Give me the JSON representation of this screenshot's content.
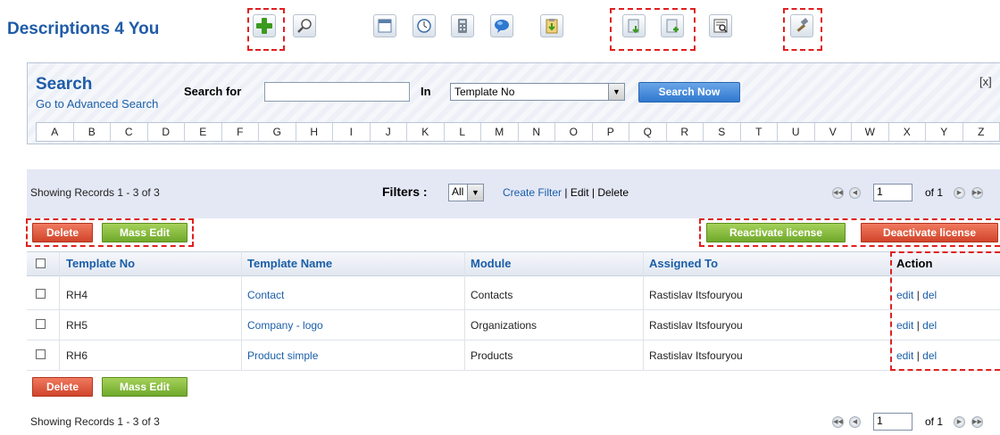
{
  "app": {
    "title": "Descriptions 4 You"
  },
  "toolbar": {
    "icons": [
      "add-icon",
      "search-icon",
      "calendar-icon",
      "clock-icon",
      "calculator-icon",
      "chat-icon",
      "clipboard-import-icon",
      "import-icon",
      "export-icon",
      "find-duplicates-icon",
      "settings-hammer-icon"
    ]
  },
  "search": {
    "title": "Search",
    "advanced_link": "Go to Advanced Search",
    "search_for_label": "Search for",
    "search_value": "",
    "in_label": "In",
    "in_selected": "Template No",
    "button": "Search Now",
    "close": "[x]",
    "alphabet": [
      "A",
      "B",
      "C",
      "D",
      "E",
      "F",
      "G",
      "H",
      "I",
      "J",
      "K",
      "L",
      "M",
      "N",
      "O",
      "P",
      "Q",
      "R",
      "S",
      "T",
      "U",
      "V",
      "W",
      "X",
      "Y",
      "Z"
    ]
  },
  "list": {
    "showing_top": "Showing Records 1 - 3 of 3",
    "showing_bottom": "Showing Records 1 - 3 of 3",
    "filters_label": "Filters :",
    "filter_selected": "All",
    "create_filter": "Create Filter",
    "sep": "|",
    "edit": "Edit",
    "delete": "Delete",
    "page_value": "1",
    "page_of": "of 1"
  },
  "buttons": {
    "delete": "Delete",
    "mass_edit": "Mass Edit",
    "reactivate": "Reactivate license",
    "deactivate": "Deactivate license"
  },
  "table": {
    "headers": {
      "template_no": "Template No",
      "template_name": "Template Name",
      "module": "Module",
      "assigned_to": "Assigned To",
      "action": "Action"
    },
    "rows": [
      {
        "template_no": "RH4",
        "template_name": "Contact",
        "module": "Contacts",
        "assigned_to": "Rastislav Itsfouryou",
        "edit": "edit",
        "sep": "|",
        "del": "del"
      },
      {
        "template_no": "RH5",
        "template_name": "Company - logo",
        "module": "Organizations",
        "assigned_to": "Rastislav Itsfouryou",
        "edit": "edit",
        "sep": "|",
        "del": "del"
      },
      {
        "template_no": "RH6",
        "template_name": "Product simple",
        "module": "Products",
        "assigned_to": "Rastislav Itsfouryou",
        "edit": "edit",
        "sep": "|",
        "del": "del"
      }
    ]
  },
  "colors": {
    "accent": "#1f5ba8",
    "red_button": "#d0442a",
    "green_button": "#6fa92b",
    "highlight": "#e02020"
  }
}
